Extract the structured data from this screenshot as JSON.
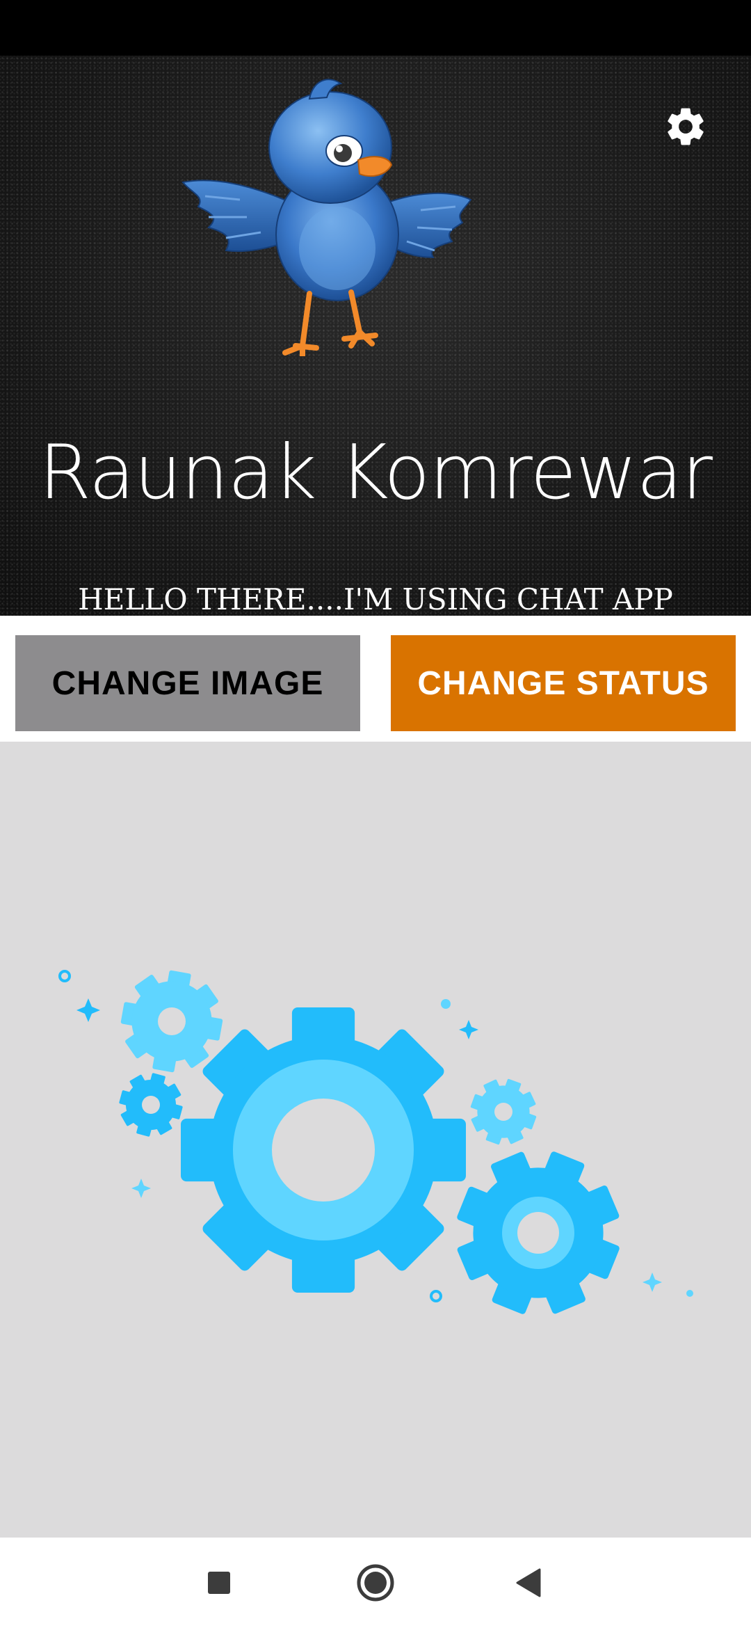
{
  "profile": {
    "name": "Raunak Komrewar",
    "status": "HELLO THERE....I'M USING CHAT APP"
  },
  "actions": {
    "change_image_label": "CHANGE IMAGE",
    "change_status_label": "CHANGE STATUS"
  },
  "icons": {
    "settings": "gear-icon",
    "avatar": "bluebird-avatar",
    "illustration": "gears-illustration",
    "nav_recents": "square-icon",
    "nav_home": "circle-icon",
    "nav_back": "back-triangle-icon"
  },
  "colors": {
    "change_image_bg": "#8d8c8e",
    "change_status_bg": "#d97300",
    "gear_primary": "#22bcfb",
    "gear_light": "#5fd5ff",
    "illustration_bg": "#dcdbdc"
  }
}
